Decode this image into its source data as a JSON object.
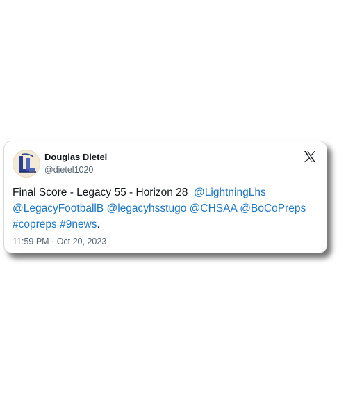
{
  "tweet": {
    "author": {
      "name": "Douglas Dietel",
      "handle": "@dietel1020",
      "avatar_text": "LL"
    },
    "platform_icon": "x-logo-icon",
    "text_lead": "Final Score - Legacy 55 - Horizon 28  ",
    "mentions": {
      "m1": "@LightningLhs",
      "m2": "@LegacyFootballB",
      "m3": "@legacyhsstugo",
      "m4": "@CHSAA",
      "m5": "@BoCoPreps"
    },
    "hashtags": {
      "h1": "#copreps",
      "h2": "#9news"
    },
    "text_end": ".",
    "time": "11:59 PM",
    "separator": " · ",
    "date": "Oct 20, 2023"
  },
  "colors": {
    "link": "#1d77c3",
    "text": "#0f1419",
    "muted": "#536471",
    "avatar_bg": "#f2ead6",
    "avatar_letters": "#2b3f8f"
  }
}
